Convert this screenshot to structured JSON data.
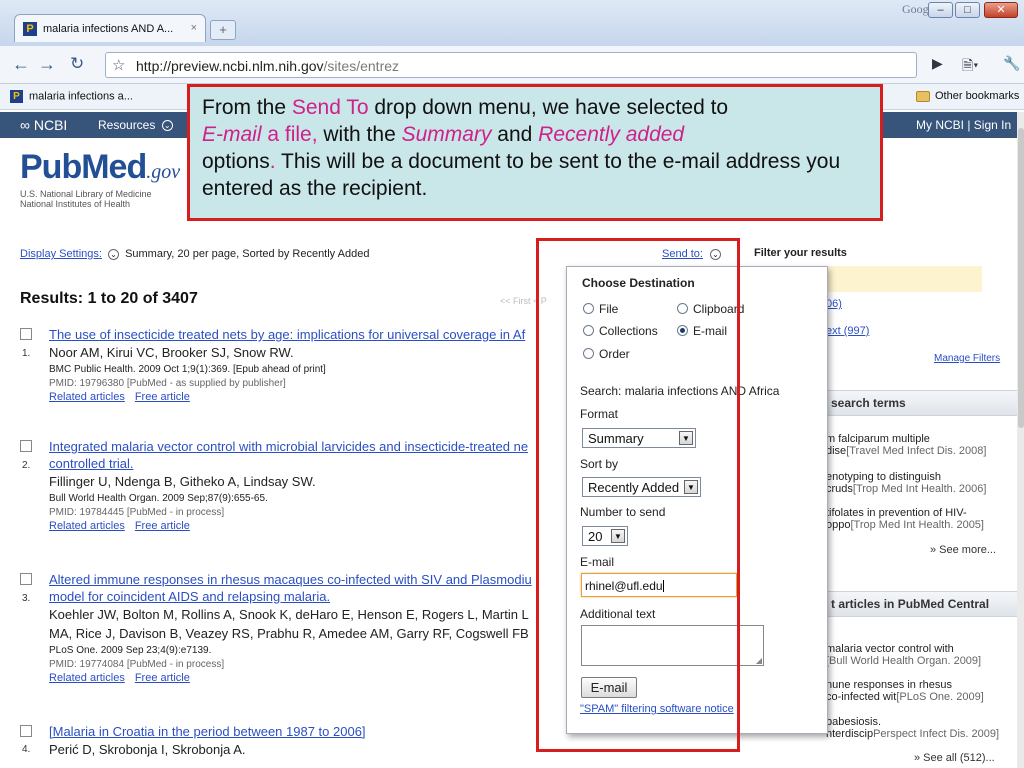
{
  "browser": {
    "tab_title": "malaria infections AND A...",
    "tab_close": "×",
    "new_tab": "+",
    "brand": "Google",
    "url_host": "http://preview.ncbi.nlm.nih.gov",
    "url_path": "/sites/entrez",
    "bookmark": "malaria infections a...",
    "other_bookmarks": "Other bookmarks"
  },
  "ncbi": {
    "logo": "NCBI",
    "resources": "Resources",
    "account": "My NCBI | Sign In"
  },
  "pubmed": {
    "logo_word": "PubMed",
    "logo_gov": ".gov",
    "sub1": "U.S. National Library of Medicine",
    "sub2": "National Institutes of Health"
  },
  "display": {
    "link": "Display Settings:",
    "summary": "Summary, 20 per page, Sorted by Recently Added"
  },
  "results_heading": "Results: 1 to 20 of 3407",
  "pager": "<< First  < P",
  "results": [
    {
      "num": "1.",
      "title": "The use of insecticide treated nets by age: implications for universal coverage in Af",
      "authors": "Noor AM, Kirui VC, Brooker SJ, Snow RW.",
      "cite": "BMC Public Health. 2009 Oct 1;9(1):369. [Epub ahead of print]",
      "pmid": "PMID: 19796380 [PubMed - as supplied by publisher]",
      "related": "Related articles",
      "free": "Free article"
    },
    {
      "num": "2.",
      "title": "Integrated malaria vector control with microbial larvicides and insecticide-treated ne",
      "title2": "controlled trial.",
      "authors": "Fillinger U, Ndenga B, Githeko A, Lindsay SW.",
      "cite": "Bull World Health Organ. 2009 Sep;87(9):655-65.",
      "pmid": "PMID: 19784445 [PubMed - in process]",
      "related": "Related articles",
      "free": "Free article"
    },
    {
      "num": "3.",
      "title": "Altered immune responses in rhesus macaques co-infected with SIV and Plasmodiu",
      "title2": "model for coincident AIDS and relapsing malaria.",
      "authors": "Koehler JW, Bolton M, Rollins A, Snook K, deHaro E, Henson E, Rogers L, Martin L",
      "authors2": "MA, Rice J, Davison B, Veazey RS, Prabhu R, Amedee AM, Garry RF, Cogswell FB",
      "cite": "PLoS One. 2009 Sep 23;4(9):e7139.",
      "pmid": "PMID: 19774084 [PubMed - in process]",
      "related": "Related articles",
      "free": "Free article"
    },
    {
      "num": "4.",
      "title": "[Malaria in Croatia in the period between 1987 to 2006]",
      "authors": "Perić D, Skrobonja I, Skrobonja A."
    }
  ],
  "sidebar": {
    "send_to": "Send to:",
    "filter_title": "Filter your results",
    "filter1": "06)",
    "filter2": "ext (997)",
    "manage_filters": "Manage Filters",
    "search_terms_header": "search terms",
    "terms": [
      {
        "line1": "m falciparum multiple",
        "line2": "dise",
        "src": "[Travel Med Infect Dis. 2008]"
      },
      {
        "line1": "enotyping to distinguish",
        "line2": "cruds",
        "src": "[Trop Med Int Health. 2006]"
      },
      {
        "line1": "tifolates in prevention of HIV-",
        "line2": "oppo",
        "src": "[Trop Med Int Health. 2005]"
      }
    ],
    "see_more": "» See more...",
    "pmc_header": "t articles in PubMed Central",
    "pmc": [
      {
        "line1": "malaria vector control with",
        "src": "[Bull World Health Organ. 2009]"
      },
      {
        "line1": "nune responses in rhesus",
        "line2": "co-infected wit",
        "src": "[PLoS One. 2009]"
      },
      {
        "line1": "babesiosis.",
        "line2": "nterdiscip",
        "src": "Perspect Infect Dis. 2009]"
      }
    ],
    "see_all": "» See all (512)..."
  },
  "popup": {
    "header": "Choose Destination",
    "options": [
      {
        "label": "File",
        "selected": false
      },
      {
        "label": "Clipboard",
        "selected": false
      },
      {
        "label": "Collections",
        "selected": false
      },
      {
        "label": "E-mail",
        "selected": true
      },
      {
        "label": "Order",
        "selected": false
      }
    ],
    "search": "Search: malaria infections AND Africa",
    "format_label": "Format",
    "format_value": "Summary",
    "sort_label": "Sort by",
    "sort_value": "Recently Added",
    "number_label": "Number to send",
    "number_value": "20",
    "email_label": "E-mail",
    "email_value": "rhinel@ufl.edu",
    "additional_label": "Additional text",
    "email_button": "E-mail",
    "spam_link": "\"SPAM\" filtering software notice"
  },
  "callout": {
    "p1": "From the ",
    "send_to": "Send To",
    "p2": " drop down menu, we have selected to",
    "email_a": "E-mail",
    "p3": " a file,",
    "p4": " with the ",
    "summary": "Summary",
    "p5": " and ",
    "recently": "Recently added",
    "p6": "options",
    "p7": ".",
    "p8": "  This will be a document to be sent to the e-mail address you entered as the recipient."
  },
  "colors": {
    "highlight_red": "#d61e1e",
    "callout_bg": "#c9e6e8",
    "emphasis_pink": "#d0208c",
    "ncbi_bar": "#37547a",
    "link": "#2a4fc4"
  }
}
